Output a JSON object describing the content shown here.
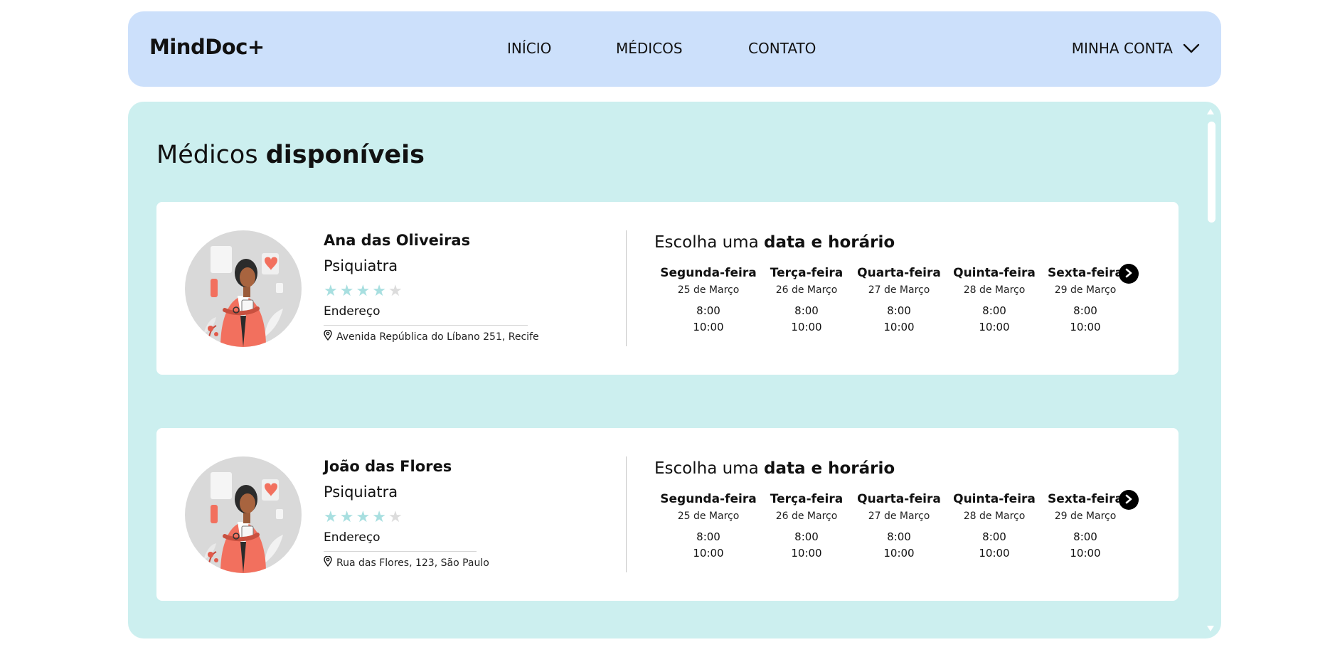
{
  "header": {
    "logo": "MindDoc+",
    "nav": [
      "INÍCIO",
      "MÉDICOS",
      "CONTATO"
    ],
    "account_label": "MINHA CONTA"
  },
  "main": {
    "title_regular": "Médicos",
    "title_bold": "disponíveis"
  },
  "doctors": [
    {
      "name": "Ana das Oliveiras",
      "specialty": "Psiquiatra",
      "rating": 4,
      "address_label": "Endereço",
      "address": "Avenida República do Líbano 251, Recife",
      "schedule_title_regular": "Escolha uma",
      "schedule_title_bold": "data e horário",
      "days": [
        {
          "name": "Segunda-feira",
          "date": "25 de Março",
          "times": [
            "8:00",
            "10:00"
          ]
        },
        {
          "name": "Terça-feira",
          "date": "26 de Março",
          "times": [
            "8:00",
            "10:00"
          ]
        },
        {
          "name": "Quarta-feira",
          "date": "27 de Março",
          "times": [
            "8:00",
            "10:00"
          ]
        },
        {
          "name": "Quinta-feira",
          "date": "28 de Março",
          "times": [
            "8:00",
            "10:00"
          ]
        },
        {
          "name": "Sexta-feira",
          "date": "29 de Março",
          "times": [
            "8:00",
            "10:00"
          ]
        }
      ]
    },
    {
      "name": "João das Flores",
      "specialty": "Psiquiatra",
      "rating": 4,
      "address_label": "Endereço",
      "address": "Rua das Flores, 123, São Paulo",
      "schedule_title_regular": "Escolha uma",
      "schedule_title_bold": "data e horário",
      "days": [
        {
          "name": "Segunda-feira",
          "date": "25 de Março",
          "times": [
            "8:00",
            "10:00"
          ]
        },
        {
          "name": "Terça-feira",
          "date": "26 de Março",
          "times": [
            "8:00",
            "10:00"
          ]
        },
        {
          "name": "Quarta-feira",
          "date": "27 de Março",
          "times": [
            "8:00",
            "10:00"
          ]
        },
        {
          "name": "Quinta-feira",
          "date": "28 de Março",
          "times": [
            "8:00",
            "10:00"
          ]
        },
        {
          "name": "Sexta-feira",
          "date": "29 de Março",
          "times": [
            "8:00",
            "10:00"
          ]
        }
      ]
    }
  ],
  "icons": {
    "account_dropdown": "chevron-down-icon",
    "address": "map-pin-icon",
    "next": "chevron-right-circle-icon",
    "star": "star-icon"
  },
  "colors": {
    "header_bg": "#cce0fb",
    "panel_bg": "#ccefef",
    "star_filled": "#a8dfe0",
    "star_empty": "#dcdcdc",
    "avatar_bg": "#d9d9d9",
    "accent_coral": "#f2705e"
  }
}
